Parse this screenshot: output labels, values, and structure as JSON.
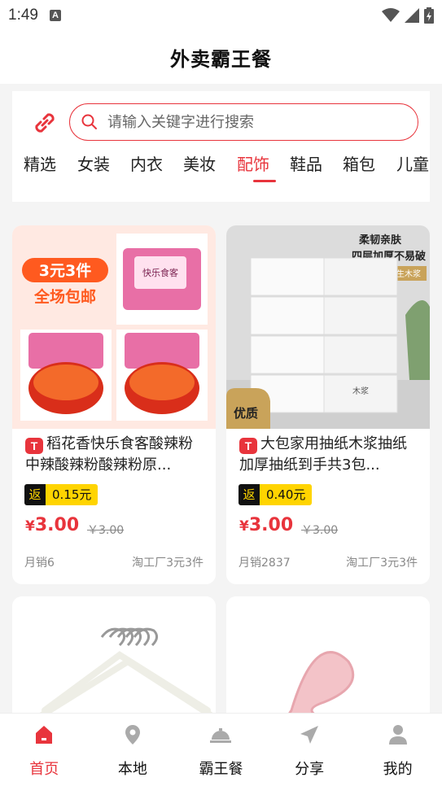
{
  "status_bar": {
    "time": "1:49",
    "notification_badge": "A"
  },
  "header": {
    "title": "外卖霸王餐"
  },
  "search": {
    "placeholder": "请输入关键字进行搜索"
  },
  "categories": [
    {
      "label": "精选"
    },
    {
      "label": "女装"
    },
    {
      "label": "内衣"
    },
    {
      "label": "美妆"
    },
    {
      "label": "配饰",
      "active": true
    },
    {
      "label": "鞋品"
    },
    {
      "label": "箱包"
    },
    {
      "label": "儿童"
    }
  ],
  "products": [
    {
      "title": "稻花香快乐食客酸辣粉中辣酸辣粉酸辣粉原...",
      "rebate_label": "返",
      "rebate_value": "0.15元",
      "price": "3.00",
      "currency": "¥",
      "original_price": "￥3.00",
      "sales": "月销6",
      "shop": "淘工厂3元3件",
      "image_promo_line1": "3元3件",
      "image_promo_line2": "全场包邮",
      "image_pack_text": "快乐食客"
    },
    {
      "title": "大包家用抽纸木浆抽纸加厚抽纸到手共3包...",
      "rebate_label": "返",
      "rebate_value": "0.40元",
      "price": "3.00",
      "currency": "¥",
      "original_price": "￥3.00",
      "sales": "月销2837",
      "shop": "淘工厂3元3件",
      "image_banner_line1": "柔韧亲肤",
      "image_banner_line2": "四层加厚不易破",
      "image_tag": "原生木浆",
      "image_quality_badge": "优质",
      "image_pack_text": "木浆"
    },
    {
      "title": "",
      "image": "white-clothes-hangers"
    },
    {
      "title": "",
      "image": "pink-hair-claw-clip"
    }
  ],
  "tabbar": [
    {
      "label": "首页",
      "icon": "home-icon",
      "active": true
    },
    {
      "label": "本地",
      "icon": "location-pin-icon"
    },
    {
      "label": "霸王餐",
      "icon": "food-cloche-icon"
    },
    {
      "label": "分享",
      "icon": "share-arrow-icon"
    },
    {
      "label": "我的",
      "icon": "user-icon"
    }
  ],
  "colors": {
    "accent": "#e8343c",
    "rebate_yellow": "#ffd400",
    "page_bg": "#f4f4f4"
  }
}
